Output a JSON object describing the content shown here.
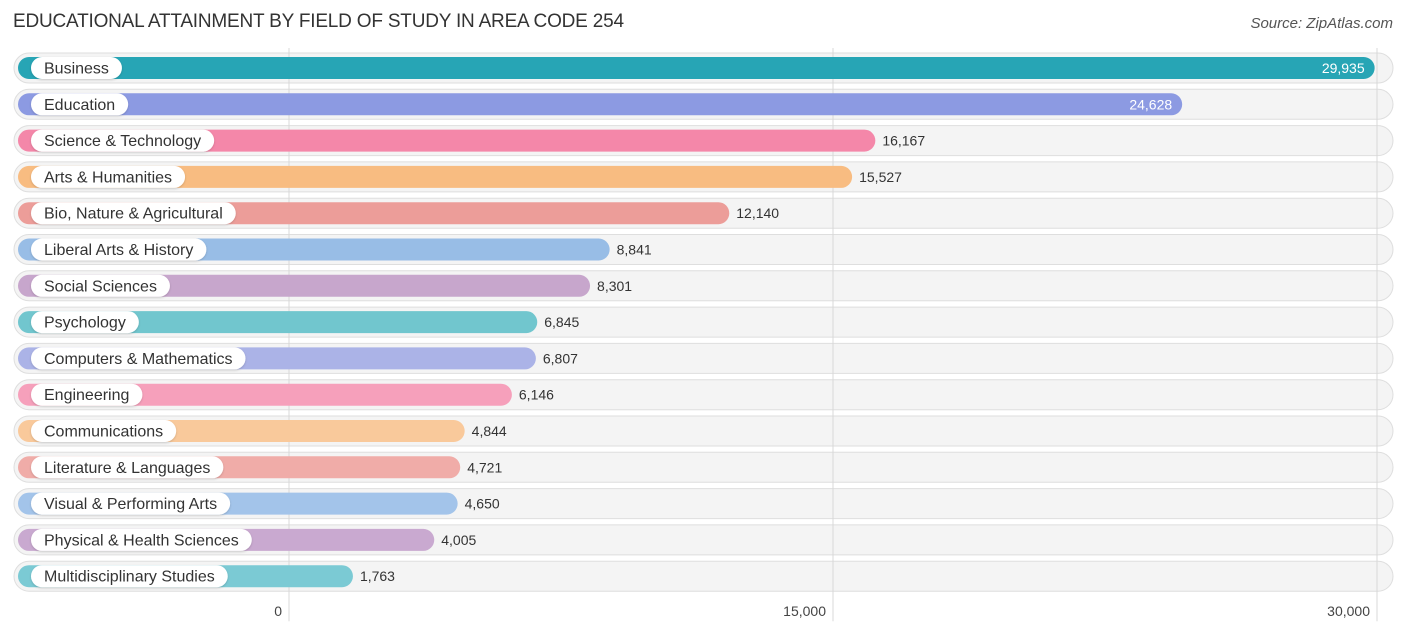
{
  "header": {
    "title": "EDUCATIONAL ATTAINMENT BY FIELD OF STUDY IN AREA CODE 254",
    "source": "Source: ZipAtlas.com"
  },
  "chart_data": {
    "type": "bar",
    "orientation": "horizontal",
    "title": "EDUCATIONAL ATTAINMENT BY FIELD OF STUDY IN AREA CODE 254",
    "source": "Source: ZipAtlas.com",
    "xlabel": "",
    "ylabel": "",
    "xlim": [
      0,
      30000
    ],
    "ticks": [
      0,
      15000,
      30000
    ],
    "tick_labels": [
      "0",
      "15,000",
      "30,000"
    ],
    "grid": true,
    "categories": [
      "Business",
      "Education",
      "Science & Technology",
      "Arts & Humanities",
      "Bio, Nature & Agricultural",
      "Liberal Arts & History",
      "Social Sciences",
      "Psychology",
      "Computers & Mathematics",
      "Engineering",
      "Communications",
      "Literature & Languages",
      "Visual & Performing Arts",
      "Physical & Health Sciences",
      "Multidisciplinary Studies"
    ],
    "values": [
      29935,
      24628,
      16167,
      15527,
      12140,
      8841,
      8301,
      6845,
      6807,
      6146,
      4844,
      4721,
      4650,
      4005,
      1763
    ],
    "value_labels": [
      "29,935",
      "24,628",
      "16,167",
      "15,527",
      "12,140",
      "8,841",
      "8,301",
      "6,845",
      "6,807",
      "6,146",
      "4,844",
      "4,721",
      "4,650",
      "4,005",
      "1,763"
    ],
    "colors": [
      "#27a5b5",
      "#8c9ae2",
      "#f487a9",
      "#f8bc81",
      "#ec9d99",
      "#98bde6",
      "#c7a6cc",
      "#71c6ce",
      "#abb3e7",
      "#f6a0bb",
      "#f9c99b",
      "#f0aca8",
      "#a3c4ea",
      "#c9a9d0",
      "#7bcad4"
    ],
    "labels_inside": [
      true,
      true,
      false,
      false,
      false,
      false,
      false,
      false,
      false,
      false,
      false,
      false,
      false,
      false,
      false
    ]
  }
}
